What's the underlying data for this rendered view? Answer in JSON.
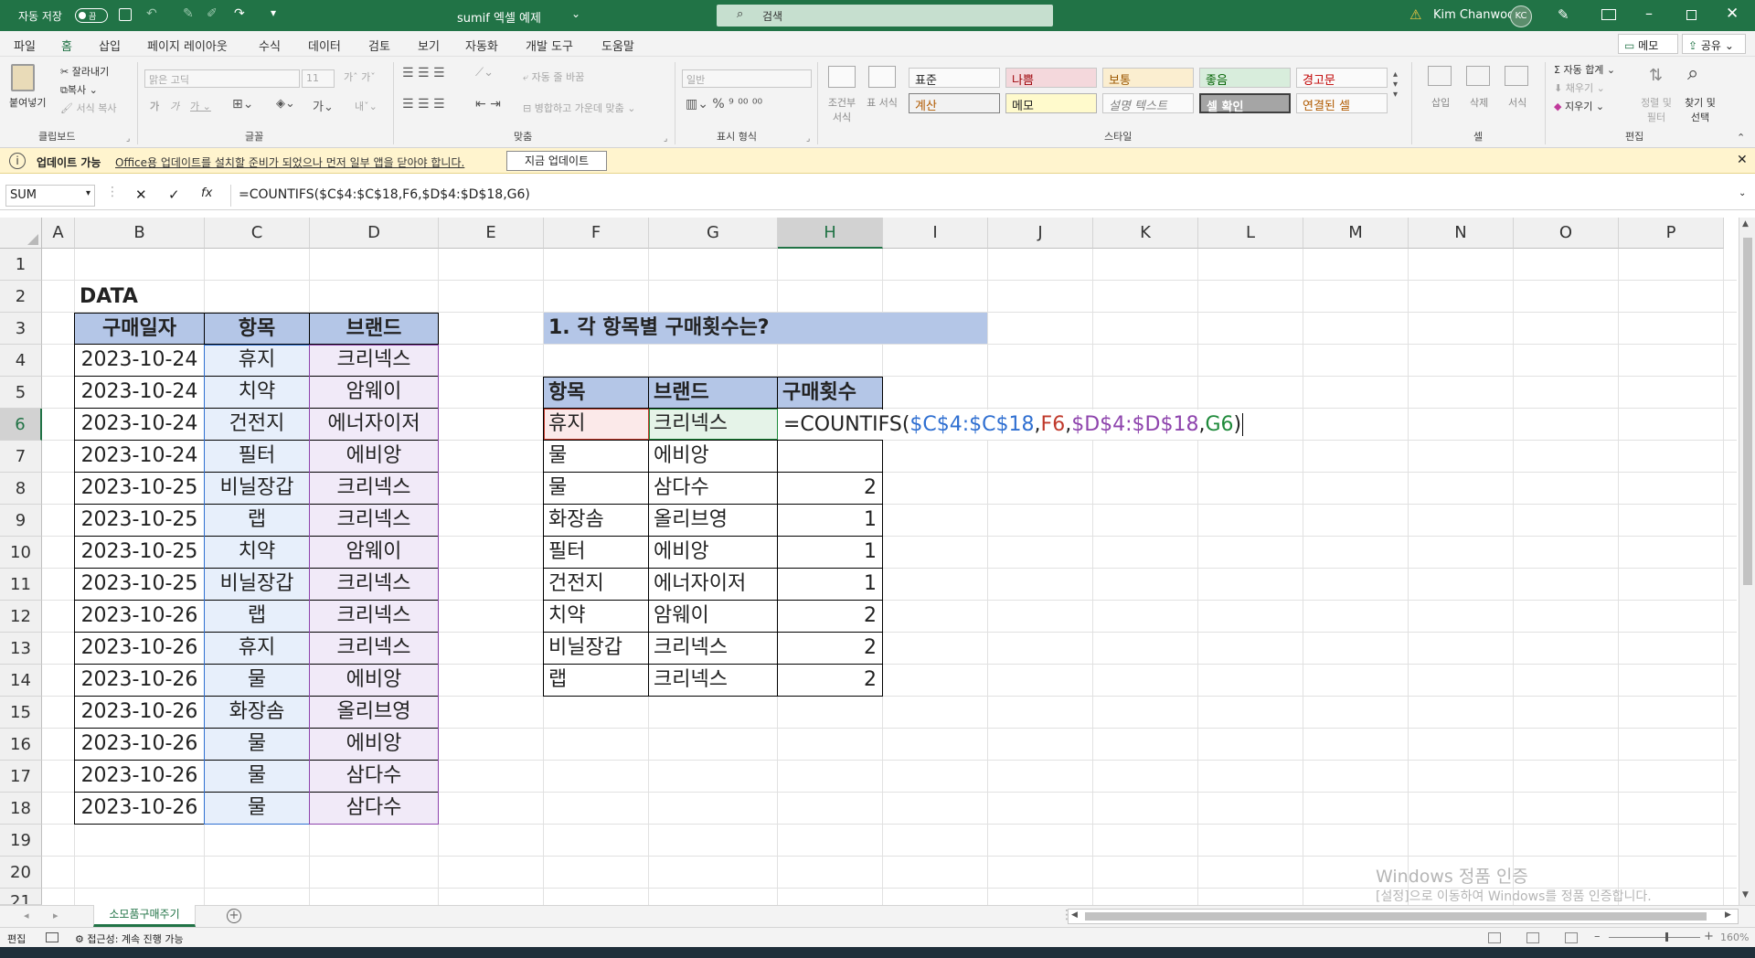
{
  "titlebar": {
    "autosave_label": "자동 저장",
    "autosave_state": "끔",
    "doc_title": "sumif 엑셀 예제",
    "search_placeholder": "검색",
    "user_name": "Kim Chanwoo",
    "user_initials": "KC"
  },
  "tabs": [
    "파일",
    "홈",
    "삽입",
    "페이지 레이아웃",
    "수식",
    "데이터",
    "검토",
    "보기",
    "자동화",
    "개발 도구",
    "도움말"
  ],
  "active_tab": "홈",
  "memo_label": "메모",
  "share_label": "공유",
  "ribbon": {
    "clipboard": {
      "paste": "붙여넣기",
      "cut": "잘라내기",
      "copy": "복사",
      "format_painter": "서식 복사",
      "group": "클립보드"
    },
    "font": {
      "name": "맑은 고딕",
      "size": "11",
      "group": "글꼴"
    },
    "align": {
      "wrap": "자동 줄 바꿈",
      "merge": "병합하고 가운데 맞춤",
      "group": "맞춤"
    },
    "number": {
      "format": "일반",
      "group": "표시 형식"
    },
    "styles": {
      "cond": "조건부 서식",
      "table": "표 서식",
      "boxes": [
        "표준",
        "나쁨",
        "보통",
        "좋음",
        "경고문",
        "계산",
        "메모",
        "설명 텍스트",
        "셀 확인",
        "연결된 셀"
      ],
      "group": "스타일"
    },
    "cells": {
      "insert": "삽입",
      "delete": "삭제",
      "format": "서식",
      "group": "셀"
    },
    "edit": {
      "autosum": "자동 합계",
      "fill": "채우기",
      "clear": "지우기",
      "sort": "정렬 및 필터",
      "find": "찾기 및 선택",
      "group": "편집"
    }
  },
  "message": {
    "title": "업데이트 가능",
    "text": "Office용 업데이트를 설치할 준비가 되었으나 먼저 일부 앱을 닫아야 합니다.",
    "button": "지금 업데이트"
  },
  "formula_bar": {
    "name_box": "SUM",
    "formula": "=COUNTIFS($C$4:$C$18,F6,$D$4:$D$18,G6)"
  },
  "columns": [
    "A",
    "B",
    "C",
    "D",
    "E",
    "F",
    "G",
    "H",
    "I",
    "J",
    "K",
    "L",
    "M",
    "N",
    "O",
    "P"
  ],
  "rows": [
    "1",
    "2",
    "3",
    "4",
    "5",
    "6",
    "7",
    "8",
    "9",
    "10",
    "11",
    "12",
    "13",
    "14",
    "15",
    "16",
    "17",
    "18",
    "19",
    "20",
    "21"
  ],
  "data_table": {
    "title": "DATA",
    "headers": [
      "구매일자",
      "항목",
      "브랜드"
    ],
    "rows": [
      [
        "2023-10-24",
        "휴지",
        "크리넥스"
      ],
      [
        "2023-10-24",
        "치약",
        "암웨이"
      ],
      [
        "2023-10-24",
        "건전지",
        "에너자이저"
      ],
      [
        "2023-10-24",
        "필터",
        "에비앙"
      ],
      [
        "2023-10-25",
        "비닐장갑",
        "크리넥스"
      ],
      [
        "2023-10-25",
        "랩",
        "크리넥스"
      ],
      [
        "2023-10-25",
        "치약",
        "암웨이"
      ],
      [
        "2023-10-25",
        "비닐장갑",
        "크리넥스"
      ],
      [
        "2023-10-26",
        "랩",
        "크리넥스"
      ],
      [
        "2023-10-26",
        "휴지",
        "크리넥스"
      ],
      [
        "2023-10-26",
        "물",
        "에비앙"
      ],
      [
        "2023-10-26",
        "화장솜",
        "올리브영"
      ],
      [
        "2023-10-26",
        "물",
        "에비앙"
      ],
      [
        "2023-10-26",
        "물",
        "삼다수"
      ],
      [
        "2023-10-26",
        "물",
        "삼다수"
      ]
    ]
  },
  "question": {
    "title": "1. 각 항목별 구매횟수는?",
    "headers": [
      "항목",
      "브랜드",
      "구매횟수"
    ],
    "rows": [
      [
        "휴지",
        "크리넥스",
        ""
      ],
      [
        "물",
        "에비앙",
        ""
      ],
      [
        "물",
        "삼다수",
        "2"
      ],
      [
        "화장솜",
        "올리브영",
        "1"
      ],
      [
        "필터",
        "에비앙",
        "1"
      ],
      [
        "건전지",
        "에너자이저",
        "1"
      ],
      [
        "치약",
        "암웨이",
        "2"
      ],
      [
        "비닐장갑",
        "크리넥스",
        "2"
      ],
      [
        "랩",
        "크리넥스",
        "2"
      ]
    ],
    "editing_formula": {
      "eq": "=COUNTIFS(",
      "a1": "$C$4:$C$18",
      "c1": ",",
      "a2": "F6",
      "c2": ",",
      "a3": "$D$4:$D$18",
      "c3": ",",
      "a4": "G6",
      "end": ")"
    }
  },
  "sheet_tab": "소모품구매주기",
  "watermark": {
    "line1": "Windows 정품 인증",
    "line2": "[설정]으로 이동하여 Windows를 정품 인증합니다."
  },
  "status": {
    "mode": "편집",
    "accessibility": "접근성: 계속 진행 가능",
    "zoom": "160%"
  },
  "colors": {
    "excel_green": "#217346",
    "header_blue": "#b4c6e7",
    "col_c_fill": "#e7effb",
    "col_d_fill": "#f1eaf8",
    "ref_blue": "#2f6fd1",
    "ref_red": "#c0392b",
    "ref_purple": "#8e44ad",
    "ref_green": "#1e8a3a"
  }
}
